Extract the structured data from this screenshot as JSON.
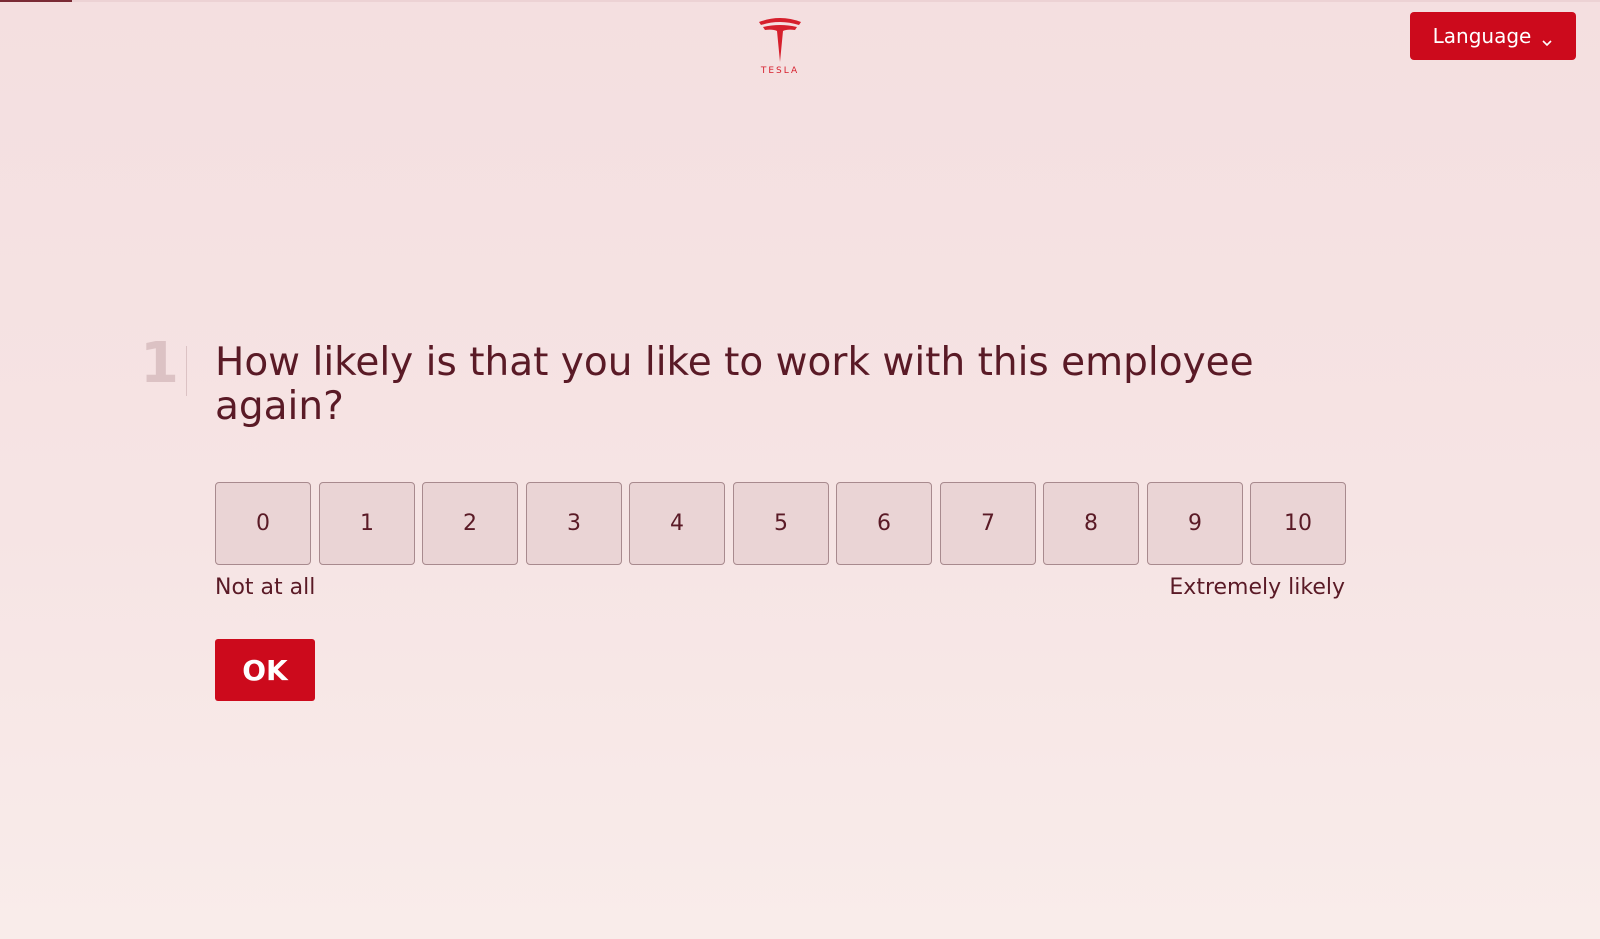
{
  "progress": {
    "fraction": 0.045
  },
  "header": {
    "logo_icon": "tesla-logo-icon",
    "logo_text": "TESLA",
    "language_label": "Language",
    "language_icon": "chevron-down-icon"
  },
  "question": {
    "number": "1",
    "title": "How likely is that you like to work with this employee again?",
    "options": [
      "0",
      "1",
      "2",
      "3",
      "4",
      "5",
      "6",
      "7",
      "8",
      "9",
      "10"
    ],
    "label_low": "Not at all",
    "label_high": "Extremely likely",
    "ok_label": "OK"
  },
  "colors": {
    "accent": "#cc0a1c",
    "text": "#5a1a26",
    "option_bg": "#ead4d5",
    "option_border": "#a88a8e"
  }
}
